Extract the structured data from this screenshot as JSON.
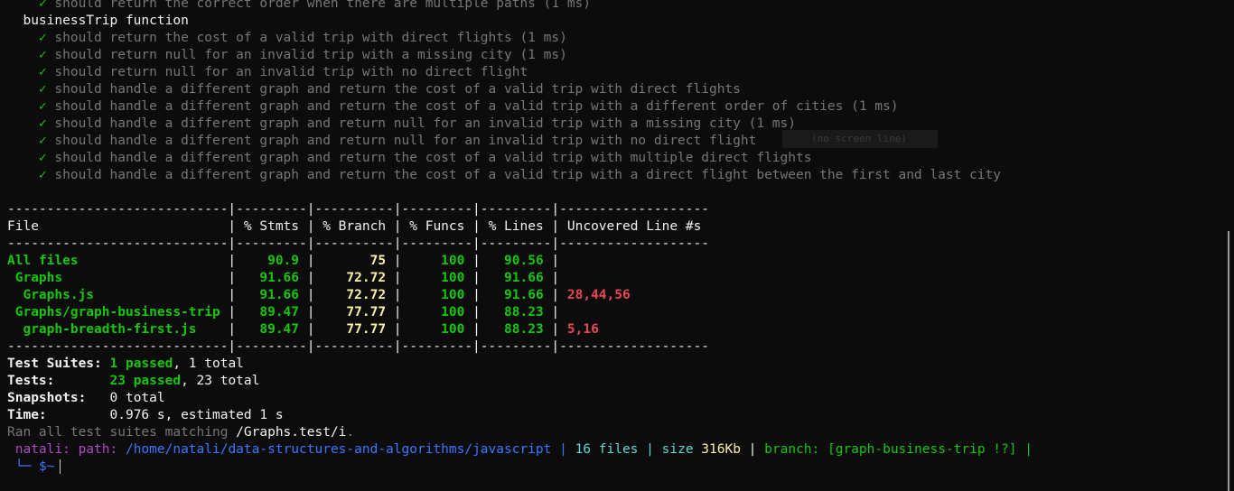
{
  "tests": {
    "check_mark": "✓",
    "top_item": "should return the correct order when there are multiple paths (1 ms)",
    "group_title": "businessTrip function",
    "items": [
      "should return the cost of a valid trip with direct flights (1 ms)",
      "should return null for an invalid trip with a missing city (1 ms)",
      "should return null for an invalid trip with no direct flight",
      "should handle a different graph and return the cost of a valid trip with direct flights",
      "should handle a different graph and return the cost of a valid trip with a different order of cities (1 ms)",
      "should handle a different graph and return null for an invalid trip with a missing city (1 ms)",
      "should handle a different graph and return null for an invalid trip with no direct flight",
      "should handle a different graph and return the cost of a valid trip with multiple direct flights",
      "should handle a different graph and return the cost of a valid trip with a direct flight between the first and last city"
    ]
  },
  "overlay": {
    "text": "(no screen line)"
  },
  "coverage": {
    "separator": "----------------------------|---------|----------|---------|---------|-------------------",
    "header": {
      "file": "File",
      "stmts": "% Stmts",
      "branch": "% Branch",
      "funcs": "% Funcs",
      "lines": "% Lines",
      "uncovered": "Uncovered Line #s"
    },
    "rows": [
      {
        "file": "All files",
        "stmts": "90.9",
        "branch": "75",
        "funcs": "100",
        "lines": "90.56",
        "uncovered": ""
      },
      {
        "file": " Graphs",
        "stmts": "91.66",
        "branch": "72.72",
        "funcs": "100",
        "lines": "91.66",
        "uncovered": ""
      },
      {
        "file": "  Graphs.js",
        "stmts": "91.66",
        "branch": "72.72",
        "funcs": "100",
        "lines": "91.66",
        "uncovered": "28,44,56"
      },
      {
        "file": " Graphs/graph-business-trip",
        "stmts": "89.47",
        "branch": "77.77",
        "funcs": "100",
        "lines": "88.23",
        "uncovered": ""
      },
      {
        "file": "  graph-breadth-first.js",
        "stmts": "89.47",
        "branch": "77.77",
        "funcs": "100",
        "lines": "88.23",
        "uncovered": "5,16"
      }
    ]
  },
  "summary": {
    "suites_label": "Test Suites:",
    "suites_passed": "1 passed",
    "suites_total": ", 1 total",
    "tests_label": "Tests:",
    "tests_passed": "23 passed",
    "tests_total": ", 23 total",
    "snapshots_label": "Snapshots:",
    "snapshots_value": "0 total",
    "time_label": "Time:",
    "time_value": "0.976 s, estimated 1 s",
    "ran_prefix": "Ran all test suites matching ",
    "ran_pattern": "/Graphs.test/i",
    "ran_suffix": "."
  },
  "prompt": {
    "user": "natali:",
    "path_label": "path:",
    "path": "/home/natali/data-structures-and-algorithms/javascript",
    "sep": "|",
    "files_count": "16 files",
    "size_label": "size",
    "size_value": "316Kb",
    "branch_label": "branch:",
    "branch_value": "[graph-business-trip !?]",
    "corner": "└─",
    "symbol": "$~"
  },
  "colors": {
    "background": "#0c0c0c",
    "pass": "#16c60c",
    "warn": "#f9f1a5",
    "fail": "#e74856",
    "user": "#b148c6",
    "path": "#3b78ff",
    "info": "#61d6d6"
  }
}
